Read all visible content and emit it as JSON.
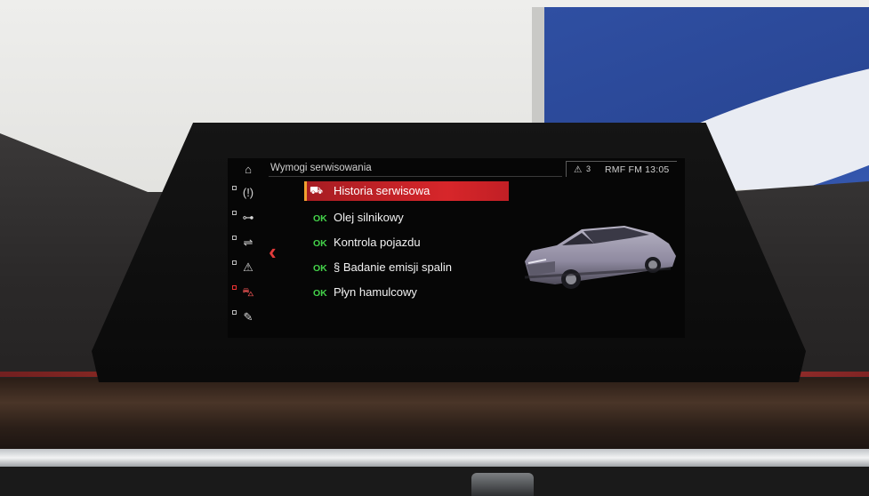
{
  "screen": {
    "title": "Wymogi serwisowania",
    "status_bar": {
      "warning_icon": "warning-triangle-icon",
      "warning_count": "3",
      "radio": "RMF FM 13:05"
    },
    "sidebar": [
      {
        "name": "home-icon",
        "glyph": "⌂"
      },
      {
        "name": "tire-pressure-icon",
        "glyph": "(!)"
      },
      {
        "name": "oil-can-icon",
        "glyph": "⊶"
      },
      {
        "name": "vehicle-check-icon",
        "glyph": "⇌"
      },
      {
        "name": "warning-icon",
        "glyph": "⚠"
      },
      {
        "name": "car-service-icon",
        "glyph": "⛍"
      },
      {
        "name": "wrench-icon",
        "glyph": "✎"
      }
    ],
    "back_label": "‹",
    "menu": [
      {
        "status": "",
        "label": "Historia serwisowa",
        "icon": "service-history-icon",
        "selected": true
      },
      {
        "status": "OK",
        "label": "Olej silnikowy"
      },
      {
        "status": "OK",
        "label": "Kontrola pojazdu"
      },
      {
        "status": "OK",
        "label": "§ Badanie emisji spalin"
      },
      {
        "status": "OK",
        "label": "Płyn hamulcowy"
      }
    ],
    "colors": {
      "selection": "#d7262a",
      "ok": "#44d34a",
      "accent_red": "#e23b3b"
    }
  }
}
